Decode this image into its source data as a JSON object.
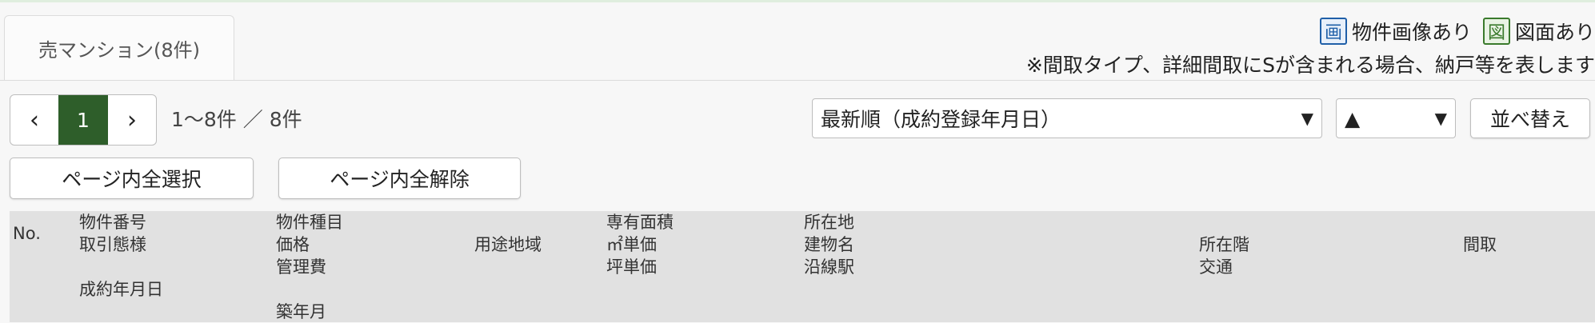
{
  "tab": {
    "label": "売マンション(8件)"
  },
  "legend": {
    "image_icon_glyph": "画",
    "image_label": "物件画像あり",
    "plan_icon_glyph": "図",
    "plan_label": "図面あり",
    "note": "※間取タイプ、詳細間取にSが含まれる場合、納戸等を表します"
  },
  "pager": {
    "prev": "‹",
    "current": "1",
    "next": "›",
    "range": "1〜8件 ／ 8件"
  },
  "sort": {
    "order_selected": "最新順（成約登録年月日）",
    "direction_selected": "▲",
    "arrow": "▼",
    "apply_label": "並べ替え"
  },
  "bulk": {
    "select_all_label": "ページ内全選択",
    "clear_all_label": "ページ内全解除"
  },
  "columns": {
    "no": "No.",
    "c1": [
      "物件番号",
      "取引態様",
      "",
      "成約年月日"
    ],
    "c2": [
      "物件種目",
      "価格",
      "管理費",
      "",
      "築年月"
    ],
    "c3": [
      "用途地域"
    ],
    "c4": [
      "専有面積",
      "㎡単価",
      "坪単価"
    ],
    "c5": [
      "所在地",
      "建物名",
      "沿線駅"
    ],
    "c6": [
      "所在階",
      "交通"
    ],
    "c7": [
      "間取"
    ]
  },
  "colors": {
    "active_page": "#2e5e2a",
    "image_icon": "#1f5fa8",
    "plan_icon": "#3a7a2c",
    "header_bg": "#e1e1e1"
  }
}
